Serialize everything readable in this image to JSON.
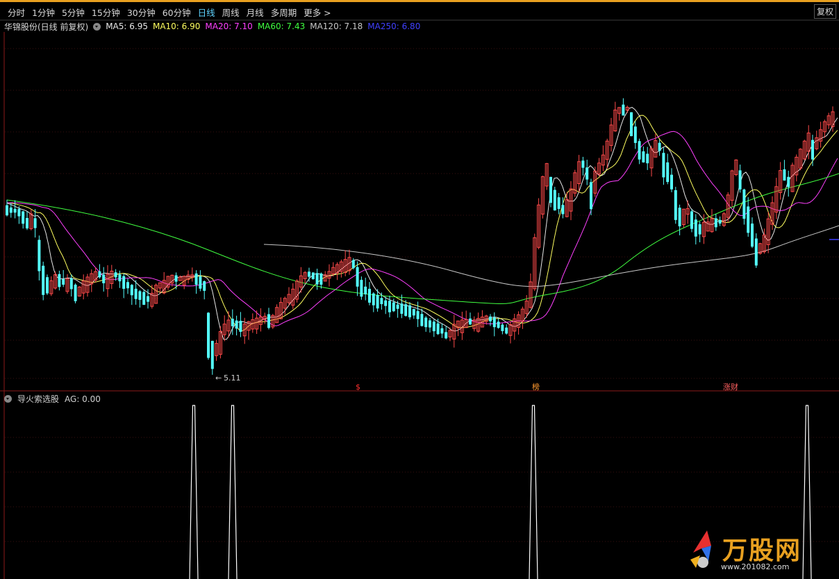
{
  "toolbar": {
    "tabs": [
      "分时",
      "1分钟",
      "5分钟",
      "15分钟",
      "30分钟",
      "60分钟",
      "日线",
      "周线",
      "月线",
      "多周期",
      "更多 >"
    ],
    "active_tab": "日线",
    "fuquan_label": "复权"
  },
  "info": {
    "stock_title": "华锦股份(日线 前复权)",
    "ma5": "MA5: 6.95",
    "ma10": "MA10: 6.90",
    "ma20": "MA20: 7.10",
    "ma60": "MA60: 7.43",
    "ma120": "MA120: 7.18",
    "ma250": "MA250: 6.80"
  },
  "colors": {
    "up": "#ff4a4a",
    "down": "#54ffff",
    "ma5": "#e8e8e8",
    "ma10": "#ffff60",
    "ma20": "#ff40ff",
    "ma60": "#40ff40",
    "ma120": "#c8c8c8",
    "ma250": "#4040ff",
    "indicator": "#ffffff"
  },
  "markers": {
    "low_price": "5.11",
    "badge_1": "$",
    "badge_2": "榜",
    "badge_3": "涨财"
  },
  "indicator": {
    "name": "导火索选股",
    "value": "AG: 0.00"
  },
  "logo": {
    "brand": "万股网",
    "url": "www.201082.com"
  },
  "chart_data": {
    "type": "candlestick",
    "series": [
      {
        "name": "MA5",
        "value": 6.95
      },
      {
        "name": "MA10",
        "value": 6.9
      },
      {
        "name": "MA20",
        "value": 7.1
      },
      {
        "name": "MA60",
        "value": 7.43
      },
      {
        "name": "MA120",
        "value": 7.18
      },
      {
        "name": "MA250",
        "value": 6.8
      }
    ],
    "annotations": [
      "5.11"
    ]
  }
}
